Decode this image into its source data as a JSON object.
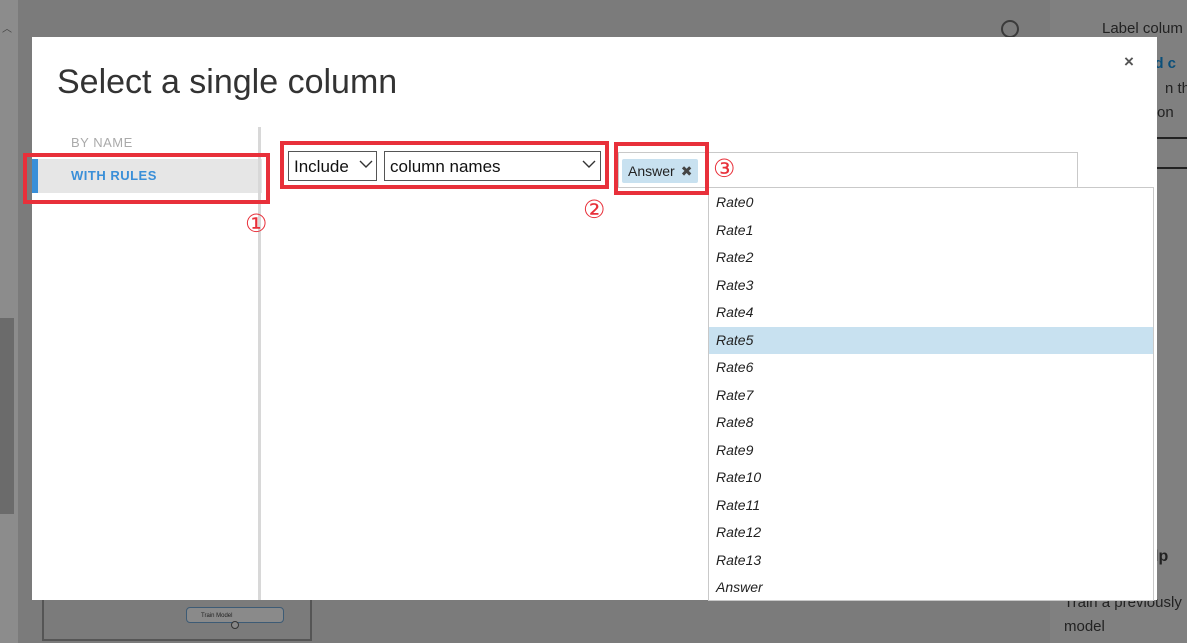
{
  "background": {
    "right_panel": {
      "label_text": "Label colum",
      "blue_text": "ed c",
      "text_line_1": "n the",
      "text_line_2": "on",
      "help_text": "lp",
      "text_line_3": "Train a previously",
      "text_line_4": "model"
    },
    "node": {
      "label": "Train Model"
    }
  },
  "dialog": {
    "title": "Select a single column",
    "close_label": "×",
    "nav": {
      "by_name": "BY NAME",
      "with_rules": "WITH RULES"
    },
    "rule": {
      "include_value": "Include",
      "columns_value": "column names"
    },
    "selected_tag": {
      "label": "Answer",
      "remove_label": "✖"
    },
    "dropdown_options": [
      "Rate0",
      "Rate1",
      "Rate2",
      "Rate3",
      "Rate4",
      "Rate5",
      "Rate6",
      "Rate7",
      "Rate8",
      "Rate9",
      "Rate10",
      "Rate11",
      "Rate12",
      "Rate13",
      "Answer"
    ],
    "selected_option": "Rate5"
  },
  "annotations": {
    "one": "①",
    "two": "②",
    "three": "③"
  },
  "colors": {
    "accent_blue": "#3a8fd8",
    "annotation_red": "#e8303a",
    "highlight": "#c8e1f0"
  }
}
